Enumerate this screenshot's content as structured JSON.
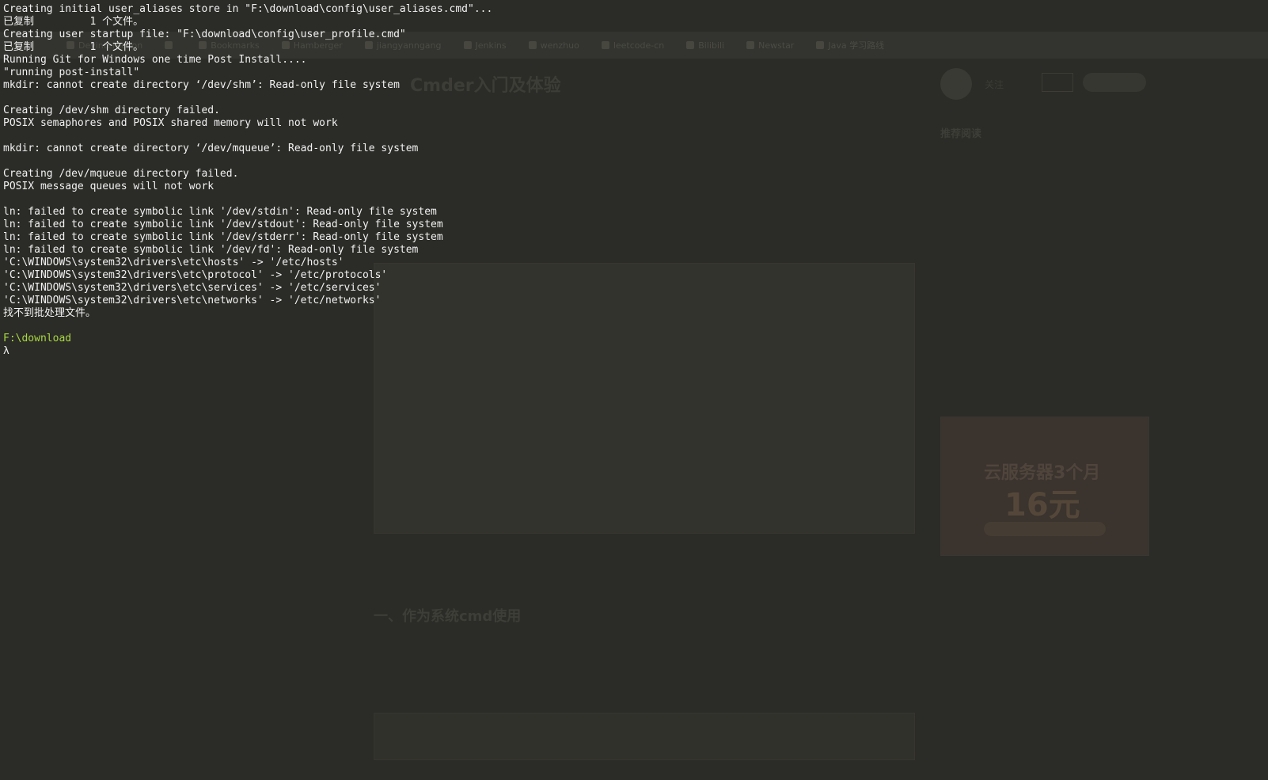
{
  "background_page": {
    "tabs": [
      "Devinteraction",
      "",
      "Bookmarks",
      "Hamberger",
      "jiangyanngang",
      "Jenkins",
      "wenzhuo",
      "leetcode-cn",
      "Bilibili",
      "Newstar",
      "Java 学习路线"
    ],
    "article": {
      "title": "Cmder入门及体验",
      "meta": "",
      "intro": "",
      "embed_caption": "",
      "embed_label": "",
      "section_heading": "一、作为系统cmd使用",
      "section_text": ""
    },
    "sidebar": {
      "follow": "关注",
      "heading": "推荐阅读",
      "items": [
        "",
        "",
        "",
        "",
        ""
      ]
    },
    "ad": {
      "line1": "",
      "line2": "云服务器3个月",
      "line3": "16元"
    }
  },
  "terminal": {
    "lines": [
      "Creating initial user_aliases store in \"F:\\download\\config\\user_aliases.cmd\"...",
      "已复制         1 个文件。",
      "Creating user startup file: \"F:\\download\\config\\user_profile.cmd\"",
      "已复制         1 个文件。",
      "Running Git for Windows one time Post Install....",
      "\"running post-install\"",
      "mkdir: cannot create directory ‘/dev/shm’: Read-only file system",
      "",
      "Creating /dev/shm directory failed.",
      "POSIX semaphores and POSIX shared memory will not work",
      "",
      "mkdir: cannot create directory ‘/dev/mqueue’: Read-only file system",
      "",
      "Creating /dev/mqueue directory failed.",
      "POSIX message queues will not work",
      "",
      "ln: failed to create symbolic link '/dev/stdin': Read-only file system",
      "ln: failed to create symbolic link '/dev/stdout': Read-only file system",
      "ln: failed to create symbolic link '/dev/stderr': Read-only file system",
      "ln: failed to create symbolic link '/dev/fd': Read-only file system",
      "'C:\\WINDOWS\\system32\\drivers\\etc\\hosts' -> '/etc/hosts'",
      "'C:\\WINDOWS\\system32\\drivers\\etc\\protocol' -> '/etc/protocols'",
      "'C:\\WINDOWS\\system32\\drivers\\etc\\services' -> '/etc/services'",
      "'C:\\WINDOWS\\system32\\drivers\\etc\\networks' -> '/etc/networks'",
      "找不到批处理文件。",
      ""
    ],
    "prompt_path": "F:\\download",
    "prompt_symbol": "λ"
  },
  "colors": {
    "background": "#2b2b27",
    "terminal_text": "#f2f2f2",
    "prompt_path": "#a8d840"
  }
}
